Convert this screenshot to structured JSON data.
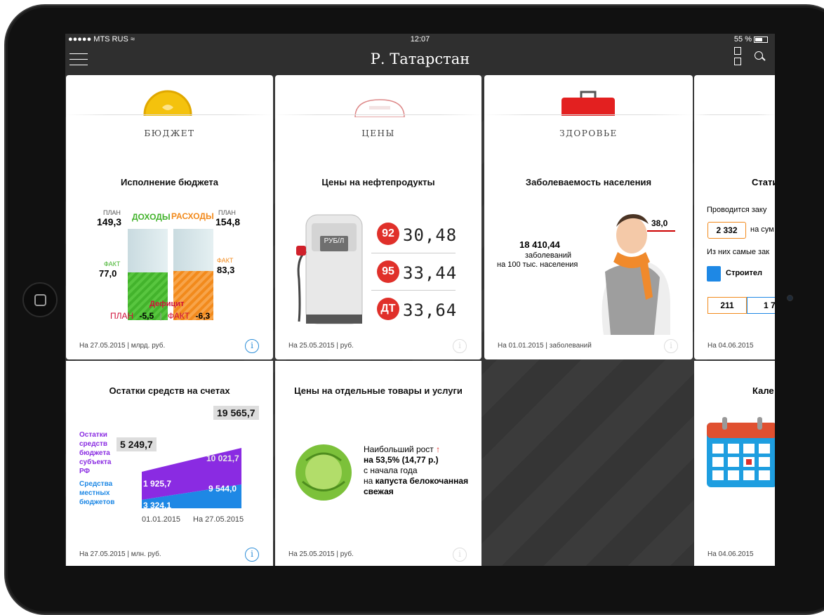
{
  "status": {
    "carrier": "●●●●● MTS RUS ≈",
    "time": "12:07",
    "battery": "55 %"
  },
  "nav": {
    "title": "Р. Татарстан"
  },
  "cards": {
    "budget": {
      "category": "БЮДЖЕТ",
      "title": "Исполнение бюджета",
      "plan_label": "ПЛАН",
      "fact_label": "ФАКТ",
      "income_label": "ДОХОДЫ",
      "expense_label": "РАСХОДЫ",
      "income_plan": "149,3",
      "income_fact": "77,0",
      "expense_plan": "154,8",
      "expense_fact": "83,3",
      "income_fill": 0.52,
      "expense_fill": 0.54,
      "deficit_label": "Дефицит",
      "deficit_plan": "-5,5",
      "deficit_fact": "-6,3",
      "footer": "На 27.05.2015 | млрд. руб."
    },
    "prices": {
      "category": "ЦЕНЫ",
      "title": "Цены на нефтепродукты",
      "pump_label": "РУБ/Л",
      "fuels": [
        {
          "grade": "92",
          "price": "30,48"
        },
        {
          "grade": "95",
          "price": "33,44"
        },
        {
          "grade": "ДТ",
          "price": "33,64"
        }
      ],
      "footer": "На 25.05.2015 | руб."
    },
    "health": {
      "category": "ЗДОРОВЬЕ",
      "title": "Заболеваемость населения",
      "value": "18 410,44",
      "unit1": "заболеваний",
      "unit2": "на 100 тыс. населения",
      "temp": "38,0",
      "footer": "На 01.01.2015 | заболеваний"
    },
    "fourth": {
      "title": "Стати",
      "line1": "Проводится заку",
      "count": "2 332",
      "count_suffix": "на сум",
      "line2": "Из них самые зак",
      "category_item": "Строител",
      "n1": "211",
      "n2": "1 7",
      "footer": "На 04.06.2015"
    },
    "accounts": {
      "title": "Остатки средств на счетах",
      "legend_subject": "Остатки средств бюджета субъекта РФ",
      "legend_local": "Средства местных бюджетов",
      "total_start": "5 249,7",
      "total_end": "19 565,7",
      "subject_start": "1 925,7",
      "subject_end": "10 021,7",
      "local_start": "3 324,1",
      "local_end": "9 544,0",
      "date_start": "01.01.2015",
      "date_end": "На 27.05.2015",
      "footer": "На 27.05.2015 | млн. руб."
    },
    "goods": {
      "title": "Цены на отдельные товары и услуги",
      "line1": "Наибольший рост",
      "line2": "на 53,5% (14,77 р.)",
      "line3": "с начала года",
      "line4_prefix": "на",
      "line4_bold": "капуста белокочанная",
      "line5": "свежая",
      "footer": "На 25.05.2015 | руб."
    },
    "calendar": {
      "title": "Кале",
      "footer": "На 04.06.2015"
    }
  },
  "colors": {
    "income": "#43b32c",
    "expense": "#f28a1c",
    "subject": "#8a2be2",
    "local": "#1e88e5",
    "badge": "#e0302a",
    "deficit": "#d0103a"
  }
}
